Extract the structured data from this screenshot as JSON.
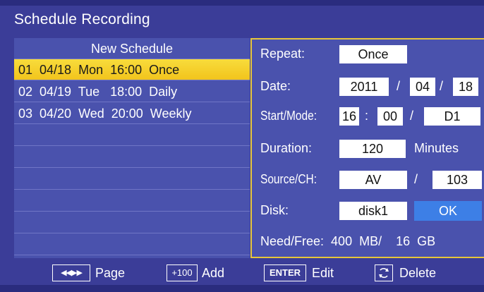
{
  "title": "Schedule Recording",
  "list": {
    "header": "New Schedule",
    "rows": [
      {
        "text": "01  04/18  Mon  16:00  Once",
        "selected": true
      },
      {
        "text": "02  04/19  Tue   18:00  Daily",
        "selected": false
      },
      {
        "text": "03  04/20  Wed  20:00  Weekly",
        "selected": false
      },
      {
        "text": "",
        "selected": false
      },
      {
        "text": "",
        "selected": false
      },
      {
        "text": "",
        "selected": false
      },
      {
        "text": "",
        "selected": false
      },
      {
        "text": "",
        "selected": false
      },
      {
        "text": "",
        "selected": false
      }
    ]
  },
  "detail": {
    "repeat_label": "Repeat:",
    "repeat_value": "Once",
    "date_label": "Date:",
    "date_year": "2011",
    "date_month": "04",
    "date_day": "18",
    "date_sep": "/",
    "start_label": "Start/Mode:",
    "start_hour": "16",
    "start_colon": ":",
    "start_min": "00",
    "mode_sep": "/",
    "mode_value": "D1",
    "duration_label": "Duration:",
    "duration_value": "120",
    "duration_unit": "Minutes",
    "source_label": "Source/CH:",
    "source_value": "AV",
    "source_sep": "/",
    "channel_value": "103",
    "disk_label": "Disk:",
    "disk_value": "disk1",
    "ok_label": "OK",
    "need_free_text": "Need/Free:  400  MB/    16  GB"
  },
  "hints": {
    "page_key": "◀◀▶▶",
    "page_label": "Page",
    "add_key": "+100",
    "add_label": "Add",
    "edit_key": "ENTER",
    "edit_label": "Edit",
    "delete_label": "Delete"
  },
  "colors": {
    "background": "#3b3d98",
    "list_bg": "#4a52ad",
    "selected_row": "#f5cf2a",
    "panel_border": "#e6c63a",
    "ok_button": "#3d7fe6"
  }
}
